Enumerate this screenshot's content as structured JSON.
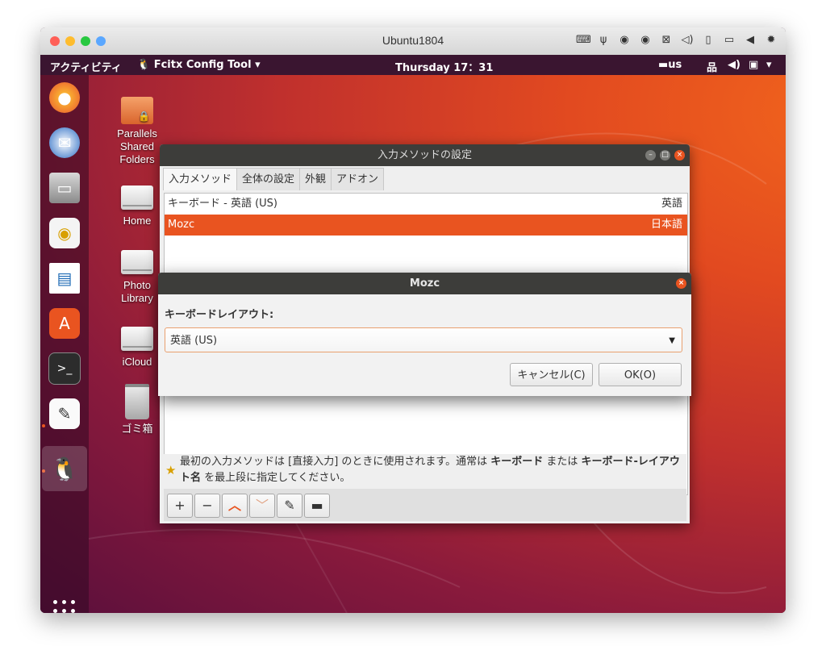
{
  "mac_window": {
    "title": "Ubuntu1804"
  },
  "colors": {
    "traffic_red": "#ff5f57",
    "traffic_yellow": "#febc2e",
    "traffic_green": "#28c840",
    "traffic_blue": "#5aa7ff",
    "accent": "#e95420"
  },
  "mac_toolbar_icons": [
    "keyboard-icon",
    "usb-icon",
    "cd-icon",
    "cd-icon-2",
    "network-off-icon",
    "volume-icon",
    "disk-icon",
    "display-icon",
    "arrow-left-icon",
    "gear-icon"
  ],
  "topbar": {
    "activities": "アクティビティ",
    "app_name": "Fcitx Config Tool",
    "clock": "Thursday 17：31",
    "keyboard_indicator": "us"
  },
  "desktop_icons": [
    {
      "label": "Parallels Shared Folders",
      "icon": "folder-shared-icon"
    },
    {
      "label": "Home",
      "icon": "drive-icon"
    },
    {
      "label": "Photo Library",
      "icon": "drive-icon"
    },
    {
      "label": "iCloud",
      "icon": "drive-icon"
    },
    {
      "label": "ゴミ箱",
      "icon": "trash-icon"
    }
  ],
  "dock": [
    "firefox-icon",
    "thunderbird-icon",
    "files-icon",
    "rhythmbox-icon",
    "writer-icon",
    "software-center-icon",
    "terminal-icon",
    "text-editor-icon",
    "fcitx-icon"
  ],
  "config_window": {
    "title": "入力メソッドの設定",
    "tabs": [
      "入力メソッド",
      "全体の設定",
      "外観",
      "アドオン"
    ],
    "rows": [
      {
        "name": "キーボード - 英語 (US)",
        "lang": "英語",
        "selected": false
      },
      {
        "name": "Mozc",
        "lang": "日本語",
        "selected": true
      }
    ],
    "note_prefix": "最初の入力メソッドは [直接入力] のときに使用されます。通常は ",
    "note_bold1": "キーボード",
    "note_mid": " または ",
    "note_bold2": "キーボード-レイアウト名",
    "note_suffix": " を最上段に指定してください。",
    "toolbar": {
      "add": "+",
      "remove": "−",
      "up": "︿",
      "down": "﹀"
    }
  },
  "dialog": {
    "title": "Mozc",
    "label": "キーボードレイアウト:",
    "selected_layout": "英語 (US)",
    "cancel": "キャンセル(C)",
    "ok": "OK(O)"
  }
}
